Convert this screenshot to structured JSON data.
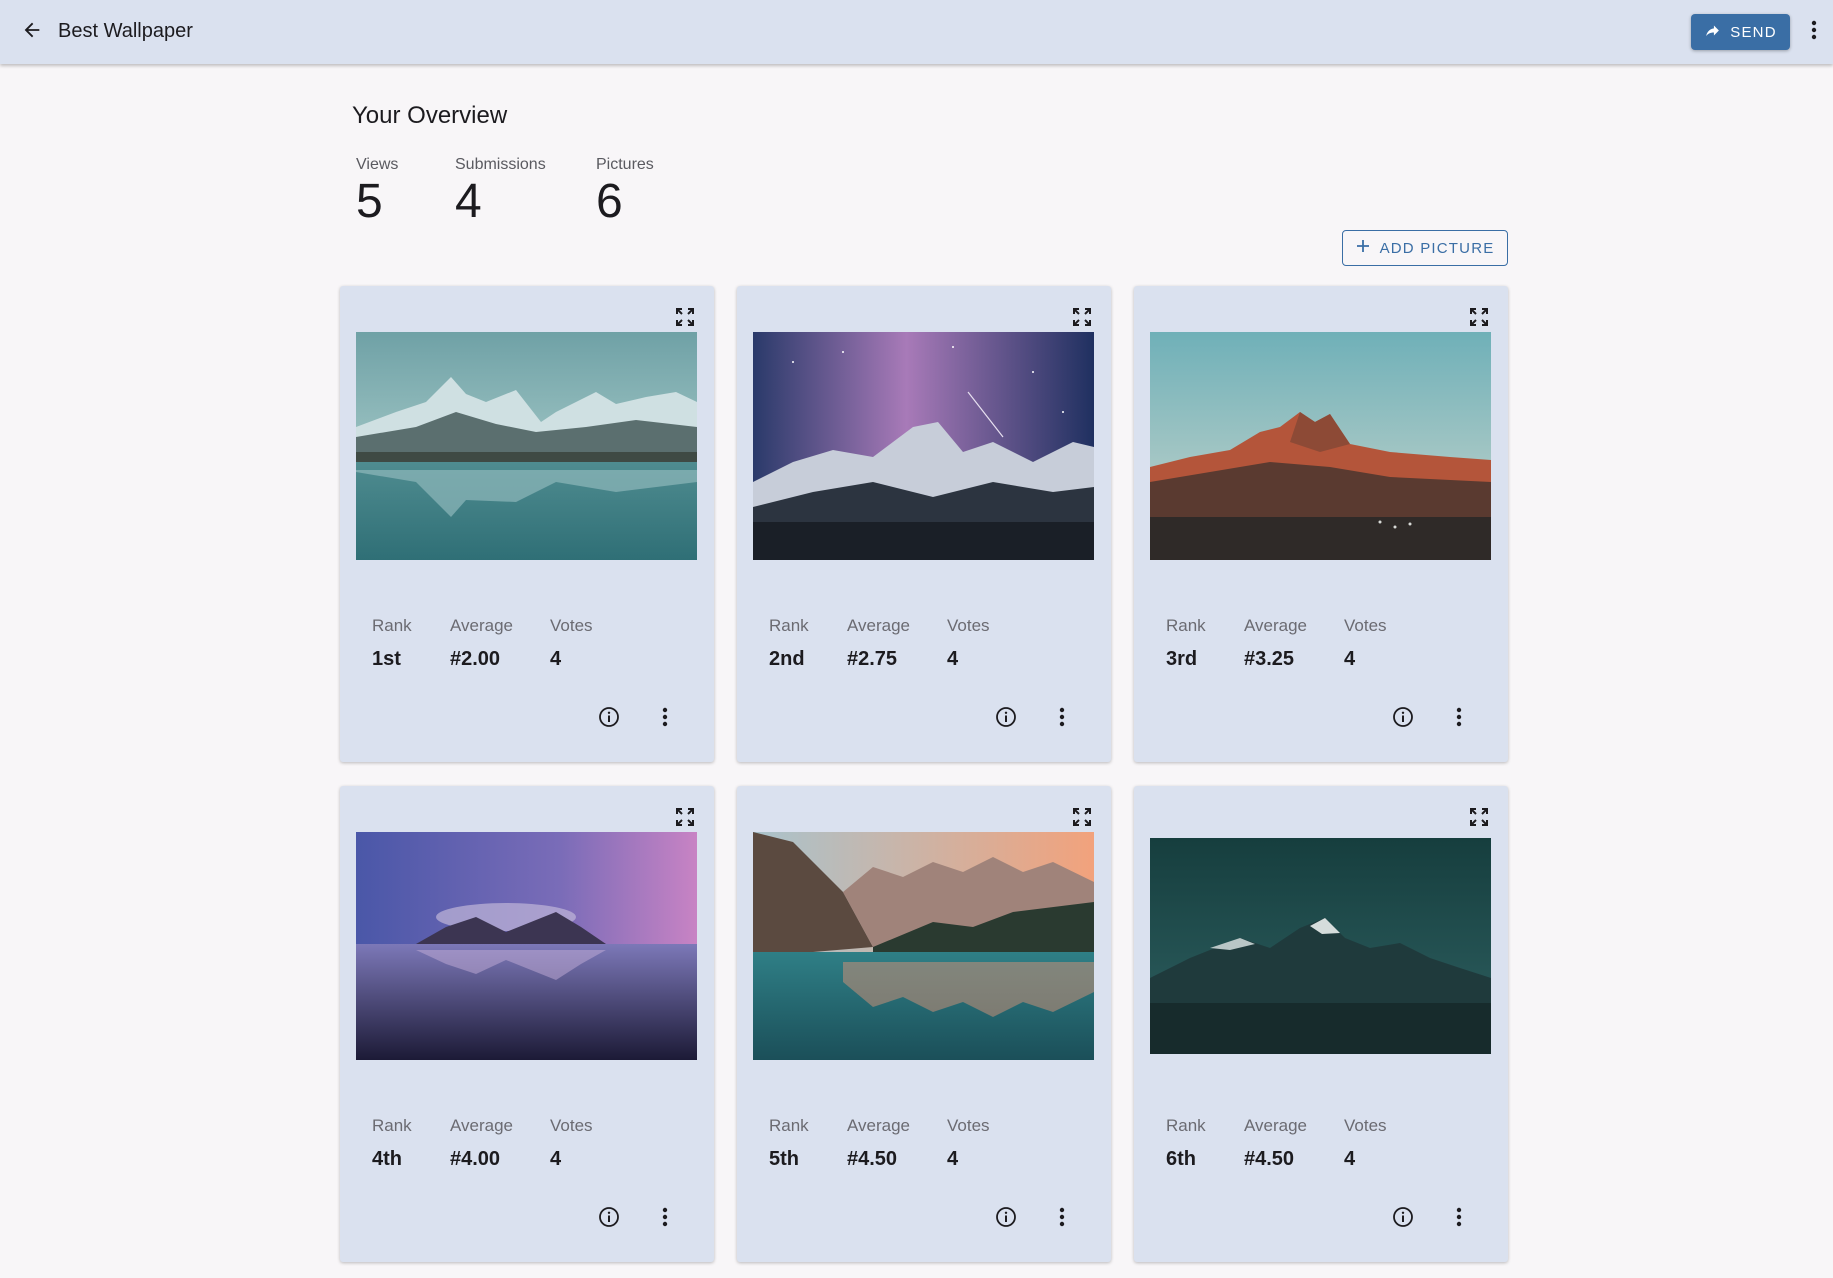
{
  "header": {
    "title": "Best Wallpaper",
    "back_icon": "arrow-left-icon",
    "send_label": "SEND",
    "send_icon": "share-arrow-icon",
    "more_icon": "more-vertical-icon"
  },
  "overview": {
    "title": "Your Overview",
    "stats": [
      {
        "label": "Views",
        "value": "5"
      },
      {
        "label": "Submissions",
        "value": "4"
      },
      {
        "label": "Pictures",
        "value": "6"
      }
    ],
    "add_picture_label": "ADD PICTURE"
  },
  "cards": [
    {
      "rank_label": "Rank",
      "rank": "1st",
      "average_label": "Average",
      "average": "#2.00",
      "votes_label": "Votes",
      "votes": "4"
    },
    {
      "rank_label": "Rank",
      "rank": "2nd",
      "average_label": "Average",
      "average": "#2.75",
      "votes_label": "Votes",
      "votes": "4"
    },
    {
      "rank_label": "Rank",
      "rank": "3rd",
      "average_label": "Average",
      "average": "#3.25",
      "votes_label": "Votes",
      "votes": "4"
    },
    {
      "rank_label": "Rank",
      "rank": "4th",
      "average_label": "Average",
      "average": "#4.00",
      "votes_label": "Votes",
      "votes": "4"
    },
    {
      "rank_label": "Rank",
      "rank": "5th",
      "average_label": "Average",
      "average": "#4.50",
      "votes_label": "Votes",
      "votes": "4"
    },
    {
      "rank_label": "Rank",
      "rank": "6th",
      "average_label": "Average",
      "average": "#4.50",
      "votes_label": "Votes",
      "votes": "4"
    }
  ],
  "colors": {
    "app_bar": "#dae1ef",
    "card": "#dae1ef",
    "primary": "#3a6ea5",
    "background": "#f8f6f8"
  }
}
